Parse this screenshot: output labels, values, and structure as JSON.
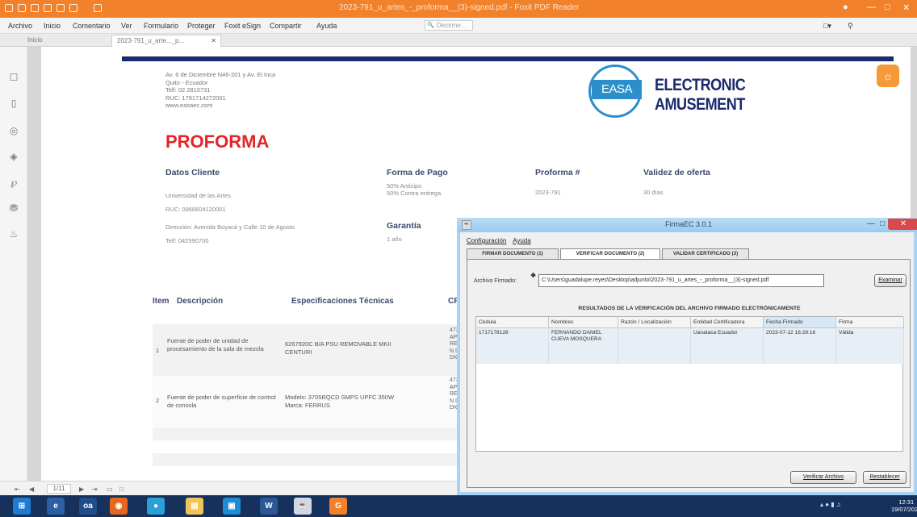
{
  "app": {
    "title": "2023-791_u_artes_-_proforma__(3)-signed.pdf - Foxit PDF Reader"
  },
  "menu": {
    "items": [
      "Archivo",
      "Inicio",
      "Comentario",
      "Ver",
      "Formulario",
      "Proteger",
      "Foxit eSign",
      "Compartir",
      "Ayuda"
    ],
    "search_placeholder": "Decirme..."
  },
  "tabs": {
    "home_label": "Inicio",
    "doc_tab_label": "2023-791_u_arte..._p..."
  },
  "document": {
    "address_lines": [
      "Av. 6 de Diciembre N46-201 y Av. El Inca",
      "Quito - Ecuador",
      "Telf: 02 2810731",
      "RUC: 1791714272001",
      "www.easaec.com"
    ],
    "logo_text": "EASA",
    "brand_line1": "ELECTRONIC",
    "brand_line2": "AMUSEMENT",
    "title": "PROFORMA",
    "client_label": "Datos Cliente",
    "client_lines": [
      "Universidad de las Artes",
      "RUC: 0968604120001",
      "Dirección: Avenida Boyacá y Calle 10 de Agosto",
      "Telf: 042590700"
    ],
    "payment_label": "Forma de Pago",
    "payment_lines": [
      "50% Anticipo",
      "50% Contra entrega"
    ],
    "warranty_label": "Garantía",
    "warranty_value": "1 año",
    "proforma_label": "Proforma #",
    "proforma_value": "2023-791",
    "validity_label": "Validez de oferta",
    "validity_value": "30 días",
    "table_headers": [
      "Item",
      "Descripción",
      "Especificaciones Técnicas",
      "CPC"
    ],
    "rows": [
      {
        "item": "1",
        "description": "Fuente de poder de unidad de procesamiento de la sala de mezcla",
        "specs": "6267920C B/A PSU REMOVABLE MKII CENTURI",
        "cpc": "473 APAR REPR N DE DIGIT"
      },
      {
        "item": "2",
        "description": "Fuente de poder de superficie de control de consola",
        "specs": "Modelo: 3705RQCD SMPS UPFC 350W Marca: FERRUS",
        "cpc": "473 APAR REPR N DE DIGIT"
      }
    ]
  },
  "statusbar": {
    "page": "1/11"
  },
  "firmaec": {
    "title": "FirmaEC 3.0.1",
    "menu": [
      "Configuración",
      "Ayuda"
    ],
    "tabs": [
      "FIRMAR DOCUMENTO (1)",
      "VERIFICAR DOCUMENTO (2)",
      "VALIDAR CERTIFICADO (3)"
    ],
    "archivo_label": "Archivo Firmado:",
    "archivo_value": "C:\\Users\\guadalupe.reyes\\Desktop\\adjunto\\2023-791_u_artes_-_proforma__(3)-signed.pdf",
    "examinar_label": "Examinar",
    "results_title": "RESULTADOS DE LA VERIFICACIÓN DEL ARCHIVO FIRMADO ELECTRÓNICAMENTE",
    "columns": [
      "Cédula",
      "Nombres",
      "Razón / Localización",
      "Entidad Certificadora",
      "Fecha Firmado",
      "Firma"
    ],
    "row": [
      "1717178128",
      "FERNANDO DANIEL CUEVA MOSQUERA",
      "",
      "Uanataca Ecuador",
      "2023-07-12 16:28:16",
      "Válida"
    ],
    "verify_button": "Verificar Archivo",
    "reset_button": "Restablecer"
  },
  "taskbar": {
    "clock_time": "12:31",
    "clock_date": "19/07/2023"
  },
  "colors": {
    "titlebar": "#f1822b",
    "proforma_red": "#e52528",
    "navy": "#1a2a6c",
    "taskbar": "#16325c"
  }
}
